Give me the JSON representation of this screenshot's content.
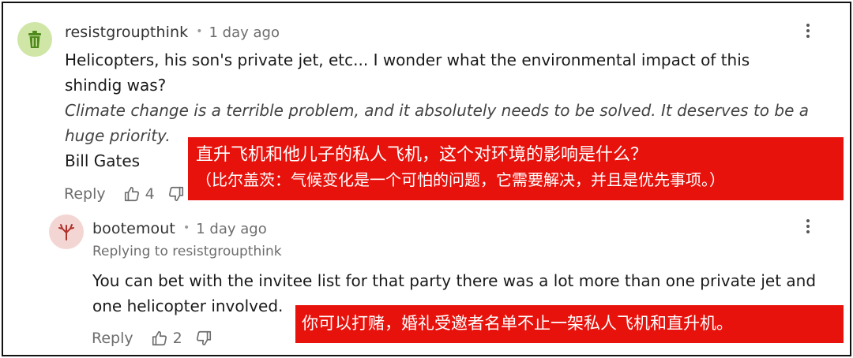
{
  "comments": [
    {
      "username": "resistgroupthink",
      "separator": "•",
      "time": "1 day ago",
      "body": "Helicopters, his son's private jet, etc... I wonder what the environmental impact of this shindig was?",
      "quote": "Climate change is a terrible problem, and it absolutely needs to be solved. It deserves to be a huge priority.",
      "attribution": "Bill Gates",
      "reply_label": "Reply",
      "likes": "4",
      "avatar_icon": "trash-can-icon",
      "avatar_color": "#cfe6a6"
    },
    {
      "username": "bootemout",
      "separator": "•",
      "time": "1 day ago",
      "replying_to": "Replying to resistgroupthink",
      "body": "You can bet with the invitee list for that party there was a lot more than one private jet and one helicopter involved.",
      "reply_label": "Reply",
      "likes": "2",
      "avatar_icon": "tree-icon",
      "avatar_color": "#f3d6d3"
    }
  ],
  "translations": {
    "comment1_line1": "直升飞机和他儿子的私人飞机，这个对环境的影响是什么？",
    "comment1_line2": "（比尔盖茨：气候变化是一个可怕的问题，它需要解决，并且是优先事项。）",
    "comment2_line1": "你可以打赌，婚礼受邀者名单不止一架私人飞机和直升机。"
  },
  "colors": {
    "translation_bg": "#e8120c",
    "muted_text": "#6d6d6d"
  }
}
